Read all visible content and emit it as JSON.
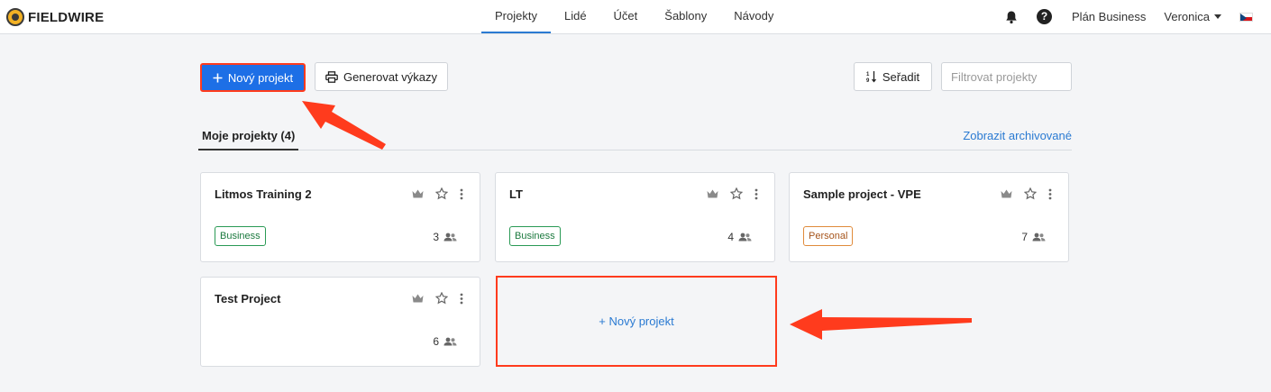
{
  "brand": {
    "name": "FIELDWIRE"
  },
  "nav": {
    "items": [
      {
        "label": "Projekty",
        "active": true
      },
      {
        "label": "Lidé",
        "active": false
      },
      {
        "label": "Účet",
        "active": false
      },
      {
        "label": "Šablony",
        "active": false
      },
      {
        "label": "Návody",
        "active": false
      }
    ]
  },
  "header_right": {
    "notification_icon": "bell-icon",
    "help_icon": "help-icon",
    "help_glyph": "?",
    "plan": "Plán Business",
    "user": "Veronica",
    "language_flag": "czech-flag-icon"
  },
  "toolbar": {
    "new_project_label": "Nový projekt",
    "generate_reports_label": "Generovat výkazy",
    "sort_label": "Seřadit",
    "filter_placeholder": "Filtrovat projekty"
  },
  "tabs": {
    "mine_label": "Moje projekty (4)",
    "archived_link": "Zobrazit archivované"
  },
  "projects": [
    {
      "title": "Litmos Training 2",
      "tag": "Business",
      "members": "3"
    },
    {
      "title": "LT",
      "tag": "Business",
      "members": "4"
    },
    {
      "title": "Sample project - VPE",
      "tag": "Personal",
      "members": "7"
    },
    {
      "title": "Test Project",
      "tag": "",
      "members": "6"
    }
  ],
  "new_project_card": {
    "label": "+ Nový projekt"
  },
  "colors": {
    "accent": "#1d6fe6",
    "link": "#2a7ad2",
    "annotation": "#ff3b1d",
    "business_tag": "#1c7a3f",
    "personal_tag": "#a6551c"
  }
}
